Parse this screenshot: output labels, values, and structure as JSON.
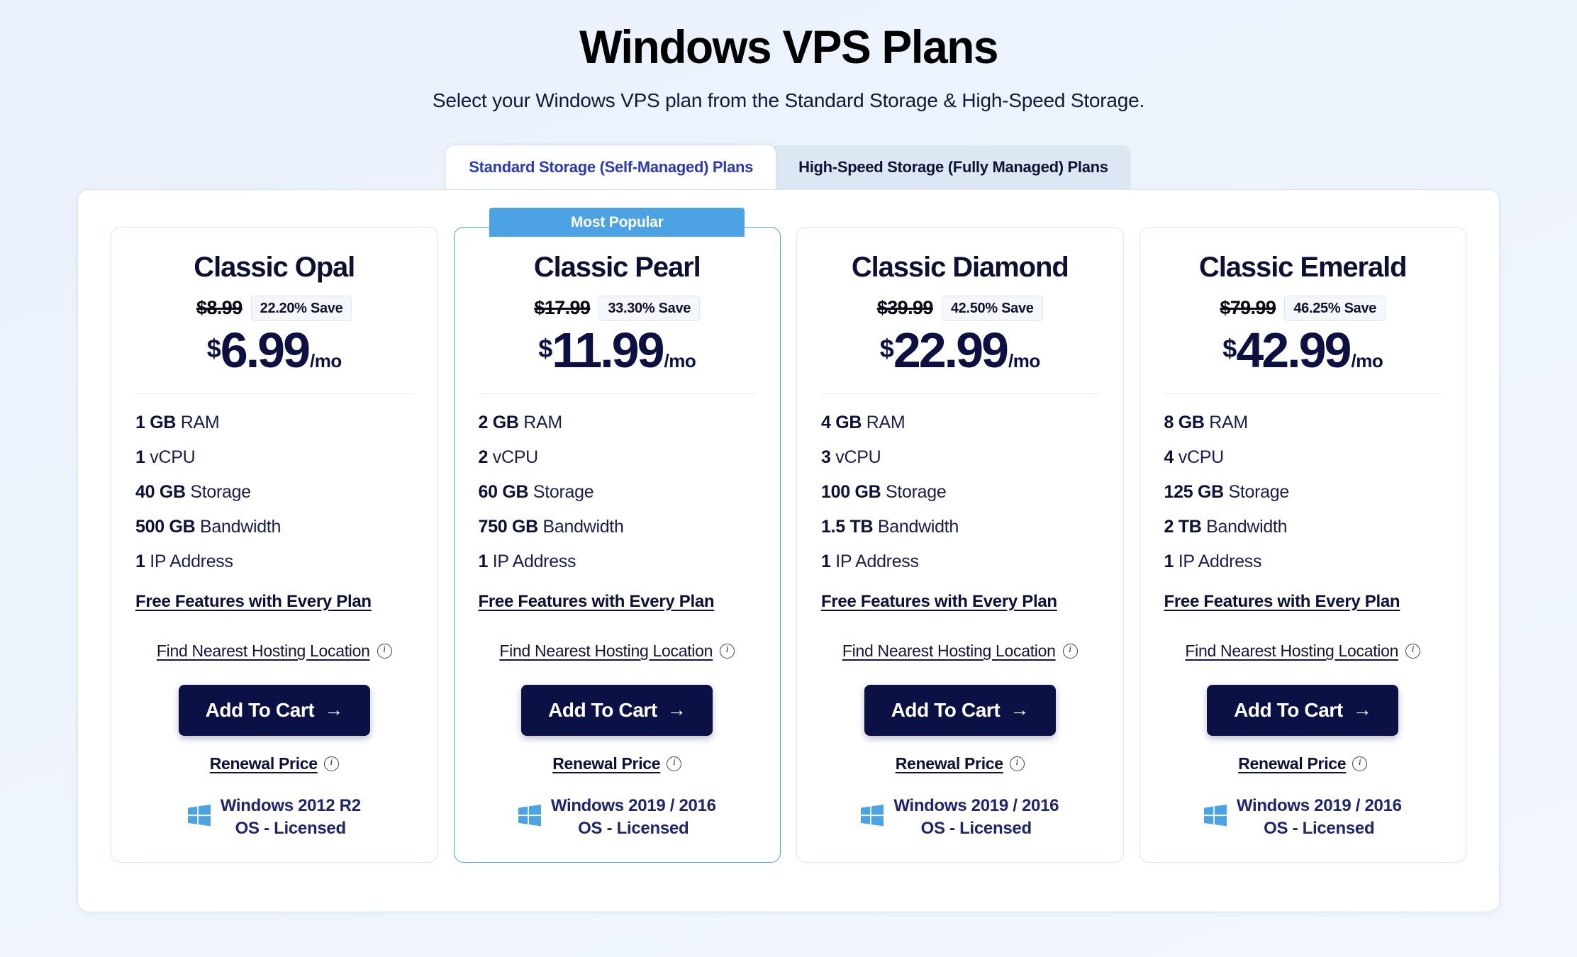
{
  "header": {
    "title": "Windows VPS Plans",
    "subtitle": "Select your Windows VPS plan from the Standard Storage & High-Speed Storage."
  },
  "tabs": [
    {
      "label": "Standard Storage (Self-Managed) Plans",
      "active": true
    },
    {
      "label": "High-Speed Storage (Fully Managed) Plans",
      "active": false
    }
  ],
  "colors": {
    "accent_blue": "#4ba3e3",
    "dark_navy": "#0c1145",
    "tab_active_text": "#2b3bb5",
    "page_background": "#eaf2fc",
    "windows_logo_blue": "#4ba3e3"
  },
  "common": {
    "popular_badge": "Most Popular",
    "currency_symbol": "$",
    "per_month": "/mo",
    "free_features_label": "Free Features with Every Plan",
    "hosting_location_label": "Find Nearest Hosting Location",
    "cta_label": "Add To Cart",
    "cta_arrow": "→",
    "renewal_label": "Renewal Price",
    "info_icon_glyph": "i",
    "os_licensed_label": "OS - Licensed"
  },
  "plans": [
    {
      "name": "Classic Opal",
      "popular": false,
      "old_price": "$8.99",
      "save_badge": "22.20% Save",
      "price": "6.99",
      "features": [
        {
          "value": "1 GB",
          "label": "RAM"
        },
        {
          "value": "1",
          "label": "vCPU"
        },
        {
          "value": "40 GB",
          "label": "Storage"
        },
        {
          "value": "500 GB",
          "label": "Bandwidth"
        },
        {
          "value": "1",
          "label": "IP Address"
        }
      ],
      "os_name": "Windows 2012 R2"
    },
    {
      "name": "Classic Pearl",
      "popular": true,
      "old_price": "$17.99",
      "save_badge": "33.30% Save",
      "price": "11.99",
      "features": [
        {
          "value": "2 GB",
          "label": "RAM"
        },
        {
          "value": "2",
          "label": "vCPU"
        },
        {
          "value": "60 GB",
          "label": "Storage"
        },
        {
          "value": "750 GB",
          "label": "Bandwidth"
        },
        {
          "value": "1",
          "label": "IP Address"
        }
      ],
      "os_name": "Windows 2019 / 2016"
    },
    {
      "name": "Classic Diamond",
      "popular": false,
      "old_price": "$39.99",
      "save_badge": "42.50% Save",
      "price": "22.99",
      "features": [
        {
          "value": "4 GB",
          "label": "RAM"
        },
        {
          "value": "3",
          "label": "vCPU"
        },
        {
          "value": "100 GB",
          "label": "Storage"
        },
        {
          "value": "1.5 TB",
          "label": "Bandwidth"
        },
        {
          "value": "1",
          "label": "IP Address"
        }
      ],
      "os_name": "Windows 2019 / 2016"
    },
    {
      "name": "Classic Emerald",
      "popular": false,
      "old_price": "$79.99",
      "save_badge": "46.25% Save",
      "price": "42.99",
      "features": [
        {
          "value": "8 GB",
          "label": "RAM"
        },
        {
          "value": "4",
          "label": "vCPU"
        },
        {
          "value": "125 GB",
          "label": "Storage"
        },
        {
          "value": "2 TB",
          "label": "Bandwidth"
        },
        {
          "value": "1",
          "label": "IP Address"
        }
      ],
      "os_name": "Windows 2019 / 2016"
    }
  ]
}
